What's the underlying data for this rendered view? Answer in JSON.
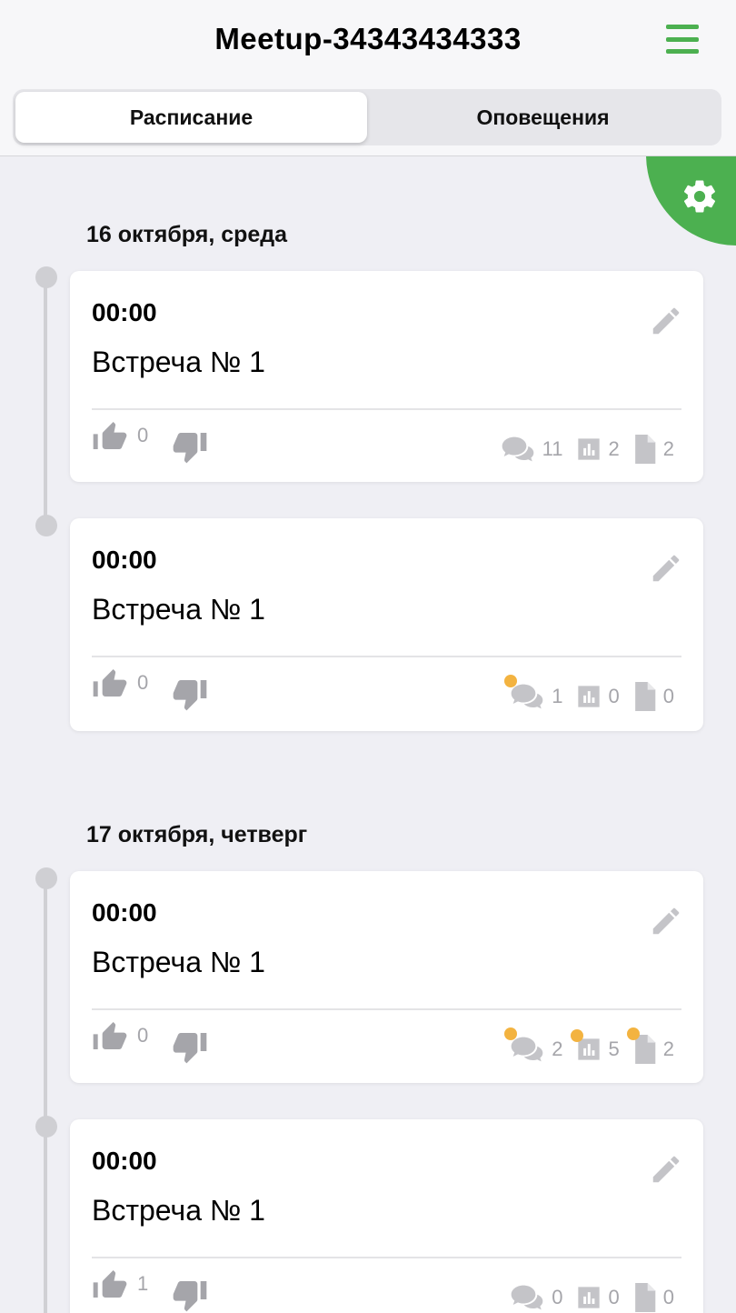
{
  "header": {
    "title": "Meetup-34343434333",
    "menu_icon": "hamburger-menu-icon",
    "accent_color": "#4cb050"
  },
  "tabs": [
    {
      "label": "Расписание",
      "active": true
    },
    {
      "label": "Оповещения",
      "active": false
    }
  ],
  "settings_button": {
    "icon": "gear-icon"
  },
  "days": [
    {
      "label": "16 октября, среда",
      "events": [
        {
          "time": "00:00",
          "title": "Встреча № 1",
          "likes": "0",
          "comments": "11",
          "polls": "2",
          "files": "2",
          "new_comments": false,
          "new_polls": false,
          "new_files": false
        },
        {
          "time": "00:00",
          "title": "Встреча № 1",
          "likes": "0",
          "comments": "1",
          "polls": "0",
          "files": "0",
          "new_comments": true,
          "new_polls": false,
          "new_files": false
        }
      ]
    },
    {
      "label": "17 октября, четверг",
      "events": [
        {
          "time": "00:00",
          "title": "Встреча № 1",
          "likes": "0",
          "comments": "2",
          "polls": "5",
          "files": "2",
          "new_comments": true,
          "new_polls": true,
          "new_files": true
        },
        {
          "time": "00:00",
          "title": "Встреча № 1",
          "likes": "1",
          "comments": "0",
          "polls": "0",
          "files": "0",
          "new_comments": false,
          "new_polls": false,
          "new_files": false
        }
      ]
    }
  ],
  "colors": {
    "notification_dot": "#f3b340",
    "icon_gray": "#a5a5aa"
  }
}
